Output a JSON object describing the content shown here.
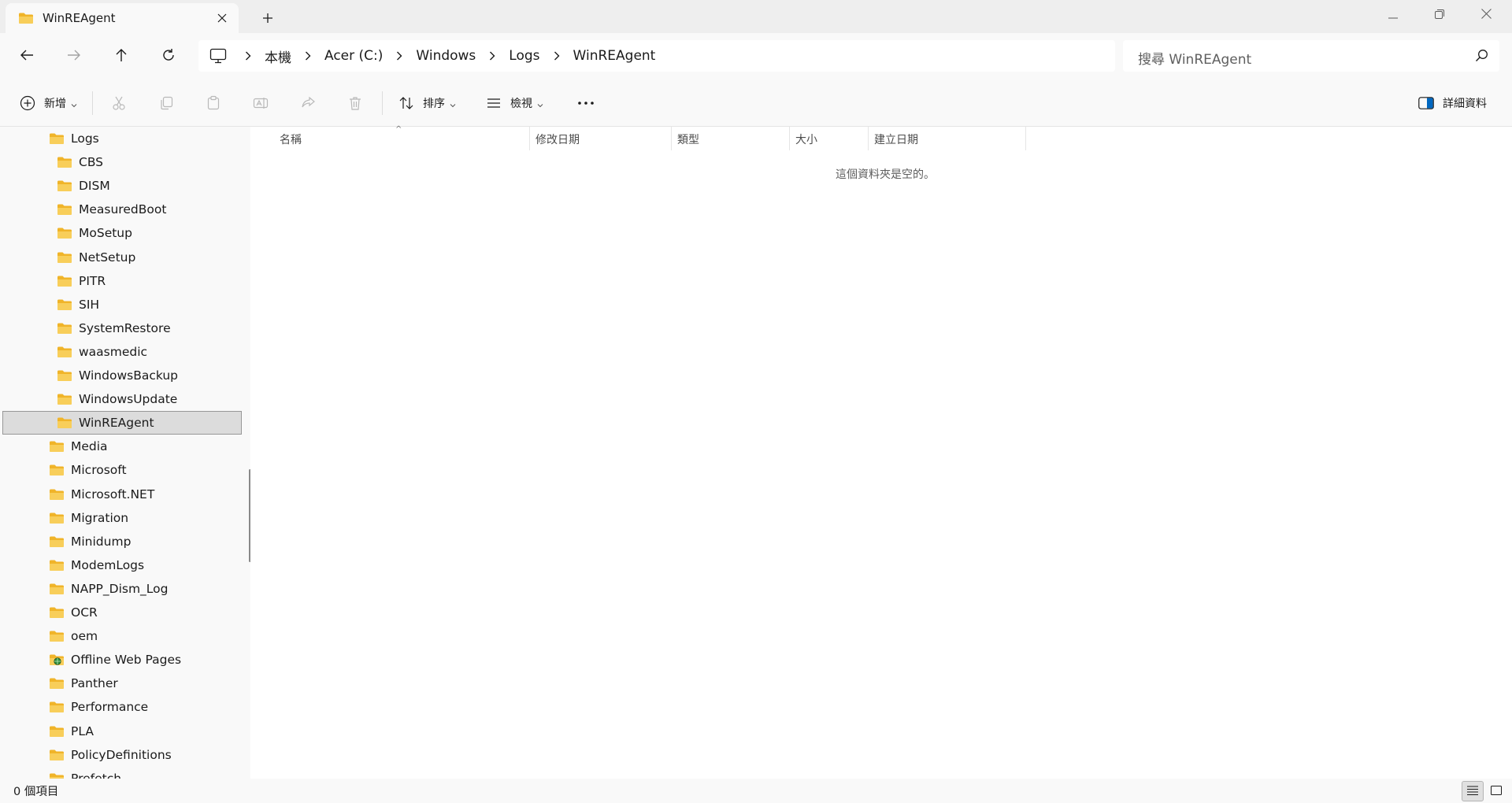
{
  "window": {
    "tab_title": "WinREAgent",
    "minimize_icon": "minimize-icon",
    "restore_icon": "restore-icon",
    "close_icon": "close-icon"
  },
  "address": {
    "crumbs": [
      "本機",
      "Acer (C:)",
      "Windows",
      "Logs",
      "WinREAgent"
    ]
  },
  "search": {
    "placeholder": "搜尋 WinREAgent"
  },
  "toolbar": {
    "new_label": "新增",
    "sort_label": "排序",
    "view_label": "檢視",
    "details_label": "詳細資料"
  },
  "nav_tree": [
    {
      "label": "Logs",
      "level": 1,
      "icon": "folder-icon"
    },
    {
      "label": "CBS",
      "level": 2,
      "icon": "folder-icon"
    },
    {
      "label": "DISM",
      "level": 2,
      "icon": "folder-icon"
    },
    {
      "label": "MeasuredBoot",
      "level": 2,
      "icon": "folder-icon"
    },
    {
      "label": "MoSetup",
      "level": 2,
      "icon": "folder-icon"
    },
    {
      "label": "NetSetup",
      "level": 2,
      "icon": "folder-icon"
    },
    {
      "label": "PITR",
      "level": 2,
      "icon": "folder-icon"
    },
    {
      "label": "SIH",
      "level": 2,
      "icon": "folder-icon"
    },
    {
      "label": "SystemRestore",
      "level": 2,
      "icon": "folder-icon"
    },
    {
      "label": "waasmedic",
      "level": 2,
      "icon": "folder-icon"
    },
    {
      "label": "WindowsBackup",
      "level": 2,
      "icon": "folder-icon"
    },
    {
      "label": "WindowsUpdate",
      "level": 2,
      "icon": "folder-icon"
    },
    {
      "label": "WinREAgent",
      "level": 2,
      "icon": "folder-icon",
      "selected": true
    },
    {
      "label": "Media",
      "level": 1,
      "icon": "folder-icon"
    },
    {
      "label": "Microsoft",
      "level": 1,
      "icon": "folder-icon"
    },
    {
      "label": "Microsoft.NET",
      "level": 1,
      "icon": "folder-icon"
    },
    {
      "label": "Migration",
      "level": 1,
      "icon": "folder-icon"
    },
    {
      "label": "Minidump",
      "level": 1,
      "icon": "folder-icon"
    },
    {
      "label": "ModemLogs",
      "level": 1,
      "icon": "folder-icon"
    },
    {
      "label": "NAPP_Dism_Log",
      "level": 1,
      "icon": "folder-icon"
    },
    {
      "label": "OCR",
      "level": 1,
      "icon": "folder-icon"
    },
    {
      "label": "oem",
      "level": 1,
      "icon": "folder-icon"
    },
    {
      "label": "Offline Web Pages",
      "level": 1,
      "icon": "offline-web-pages-icon"
    },
    {
      "label": "Panther",
      "level": 1,
      "icon": "folder-icon"
    },
    {
      "label": "Performance",
      "level": 1,
      "icon": "folder-icon"
    },
    {
      "label": "PLA",
      "level": 1,
      "icon": "folder-icon"
    },
    {
      "label": "PolicyDefinitions",
      "level": 1,
      "icon": "folder-icon"
    },
    {
      "label": "Prefetch",
      "level": 1,
      "icon": "folder-icon"
    }
  ],
  "columns": [
    "名稱",
    "修改日期",
    "類型",
    "大小",
    "建立日期"
  ],
  "empty_message": "這個資料夾是空的。",
  "status": {
    "item_count": "0 個項目"
  },
  "colors": {
    "folder": "#F8CE5A",
    "selected_bg": "#DCDCDC",
    "accent": "#0067C0"
  }
}
